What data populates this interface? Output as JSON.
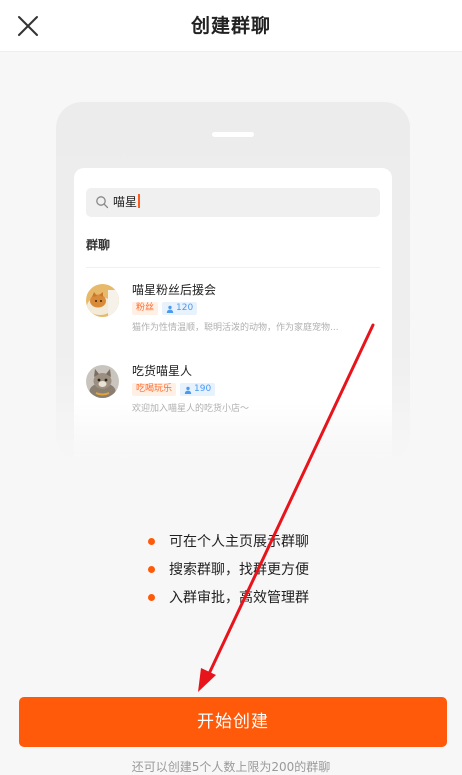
{
  "header": {
    "title": "创建群聊",
    "close_icon": "close-icon"
  },
  "illustration": {
    "search": {
      "query": "喵星",
      "icon": "search-icon"
    },
    "section_label": "群聊",
    "groups": [
      {
        "name": "喵星粉丝后援会",
        "tag": "粉丝",
        "members": "120",
        "description": "猫作为性情温顺，聪明活泼的动物，作为家庭宠物..."
      },
      {
        "name": "吃货喵星人",
        "tag": "吃喝玩乐",
        "members": "190",
        "description": "欢迎加入喵星人的吃货小店～"
      }
    ]
  },
  "features": [
    "可在个人主页展示群聊",
    "搜索群聊，找群更方便",
    "入群审批，高效管理群"
  ],
  "cta": {
    "label": "开始创建"
  },
  "footer": {
    "quota_text": "还可以创建5个人数上限为200的群聊"
  },
  "colors": {
    "accent": "#ff5a0a",
    "annotation_arrow": "#e8141c"
  }
}
